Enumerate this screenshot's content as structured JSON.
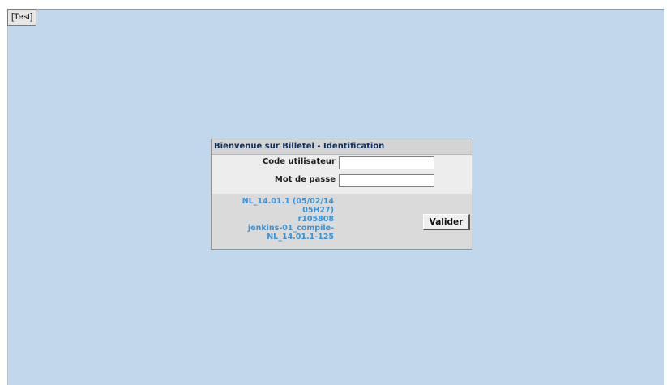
{
  "environment_tag": "[Test]",
  "login": {
    "header": "Bienvenue sur Billetel - Identification",
    "username_label": "Code utilisateur",
    "username_value": "",
    "password_label": "Mot de passe",
    "password_value": "",
    "submit_label": "Valider"
  },
  "version": {
    "lines": [
      "NL_14.01.1 (05/02/14",
      "05H27)",
      "r105808",
      "jenkins-01_compile-",
      "NL_14.01.1-125"
    ]
  },
  "colors": {
    "background": "#c0d7ec",
    "version_text": "#3a93d6",
    "header_text": "#0f2f5c"
  }
}
